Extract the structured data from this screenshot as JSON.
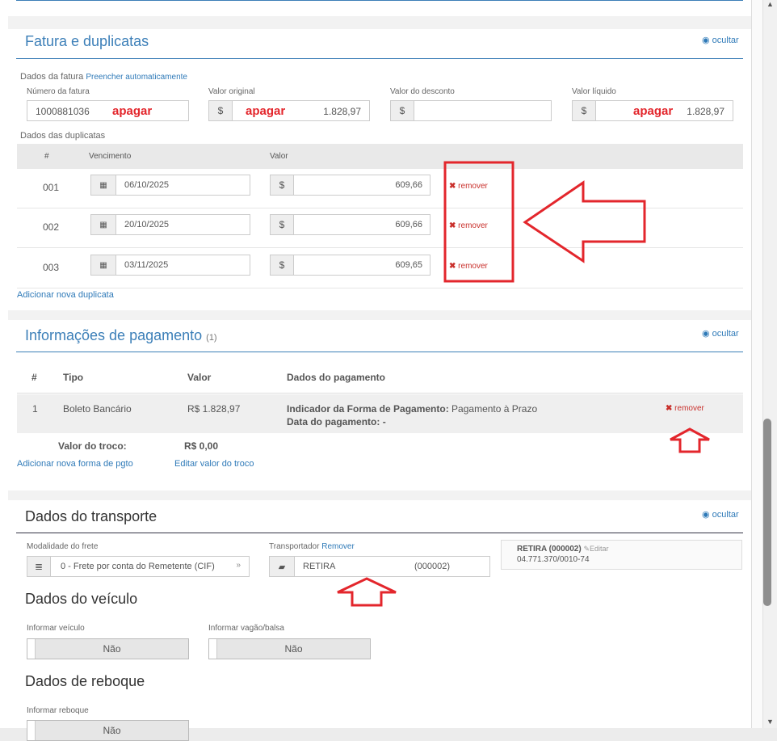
{
  "fatura": {
    "title": "Fatura e duplicatas",
    "ocultar": "ocultar",
    "dados_fatura_label": "Dados da fatura",
    "preencher": "Preencher automaticamente",
    "numero_label": "Número da fatura",
    "numero_value": "1000881036",
    "valor_original_label": "Valor original",
    "valor_original_value": "1.828,97",
    "valor_desconto_label": "Valor do desconto",
    "valor_desconto_value": "",
    "valor_liquido_label": "Valor líquido",
    "valor_liquido_value": "1.828,97",
    "currency": "$",
    "annotation_apagar": "apagar",
    "dados_duplicatas_label": "Dados das duplicatas",
    "col_num": "#",
    "col_vencimento": "Vencimento",
    "col_valor": "Valor",
    "duplicatas": [
      {
        "num": "001",
        "vencimento": "06/10/2025",
        "valor": "609,66"
      },
      {
        "num": "002",
        "vencimento": "20/10/2025",
        "valor": "609,66"
      },
      {
        "num": "003",
        "vencimento": "03/11/2025",
        "valor": "609,65"
      }
    ],
    "remover": "remover",
    "adicionar": "Adicionar nova duplicata"
  },
  "pagamento": {
    "title": "Informações de pagamento",
    "count": "(1)",
    "ocultar": "ocultar",
    "col_num": "#",
    "col_tipo": "Tipo",
    "col_valor": "Valor",
    "col_dados": "Dados do pagamento",
    "row": {
      "num": "1",
      "tipo": "Boleto Bancário",
      "valor": "R$ 1.828,97",
      "indicador_label": "Indicador da Forma de Pagamento:",
      "indicador_value": "Pagamento à Prazo",
      "data_label": "Data do pagamento:",
      "data_value": "-"
    },
    "remover": "remover",
    "troco_label": "Valor do troco:",
    "troco_value": "R$ 0,00",
    "adicionar": "Adicionar nova forma de pgto",
    "editar_troco": "Editar valor do troco"
  },
  "transporte": {
    "title": "Dados do transporte",
    "ocultar": "ocultar",
    "modalidade_label": "Modalidade do frete",
    "modalidade_value": "0 - Frete por conta do Remetente (CIF)",
    "transportador_label": "Transportador",
    "transportador_remover": "Remover",
    "transportador_name": "RETIRA",
    "transportador_code": "(000002)",
    "card_title": "RETIRA (000002)",
    "card_editar": "Editar",
    "card_cnpj": "04.771.370/0010-74",
    "veiculo_title": "Dados do veículo",
    "informar_veiculo_label": "Informar veículo",
    "informar_veiculo_value": "Não",
    "informar_vagao_label": "Informar vagão/balsa",
    "informar_vagao_value": "Não",
    "reboque_title": "Dados de reboque",
    "informar_reboque_label": "Informar reboque",
    "informar_reboque_value": "Não"
  },
  "colors": {
    "accent": "#3c7fb8",
    "annotation_red": "#e3262c",
    "remove_red": "#c9302c"
  }
}
